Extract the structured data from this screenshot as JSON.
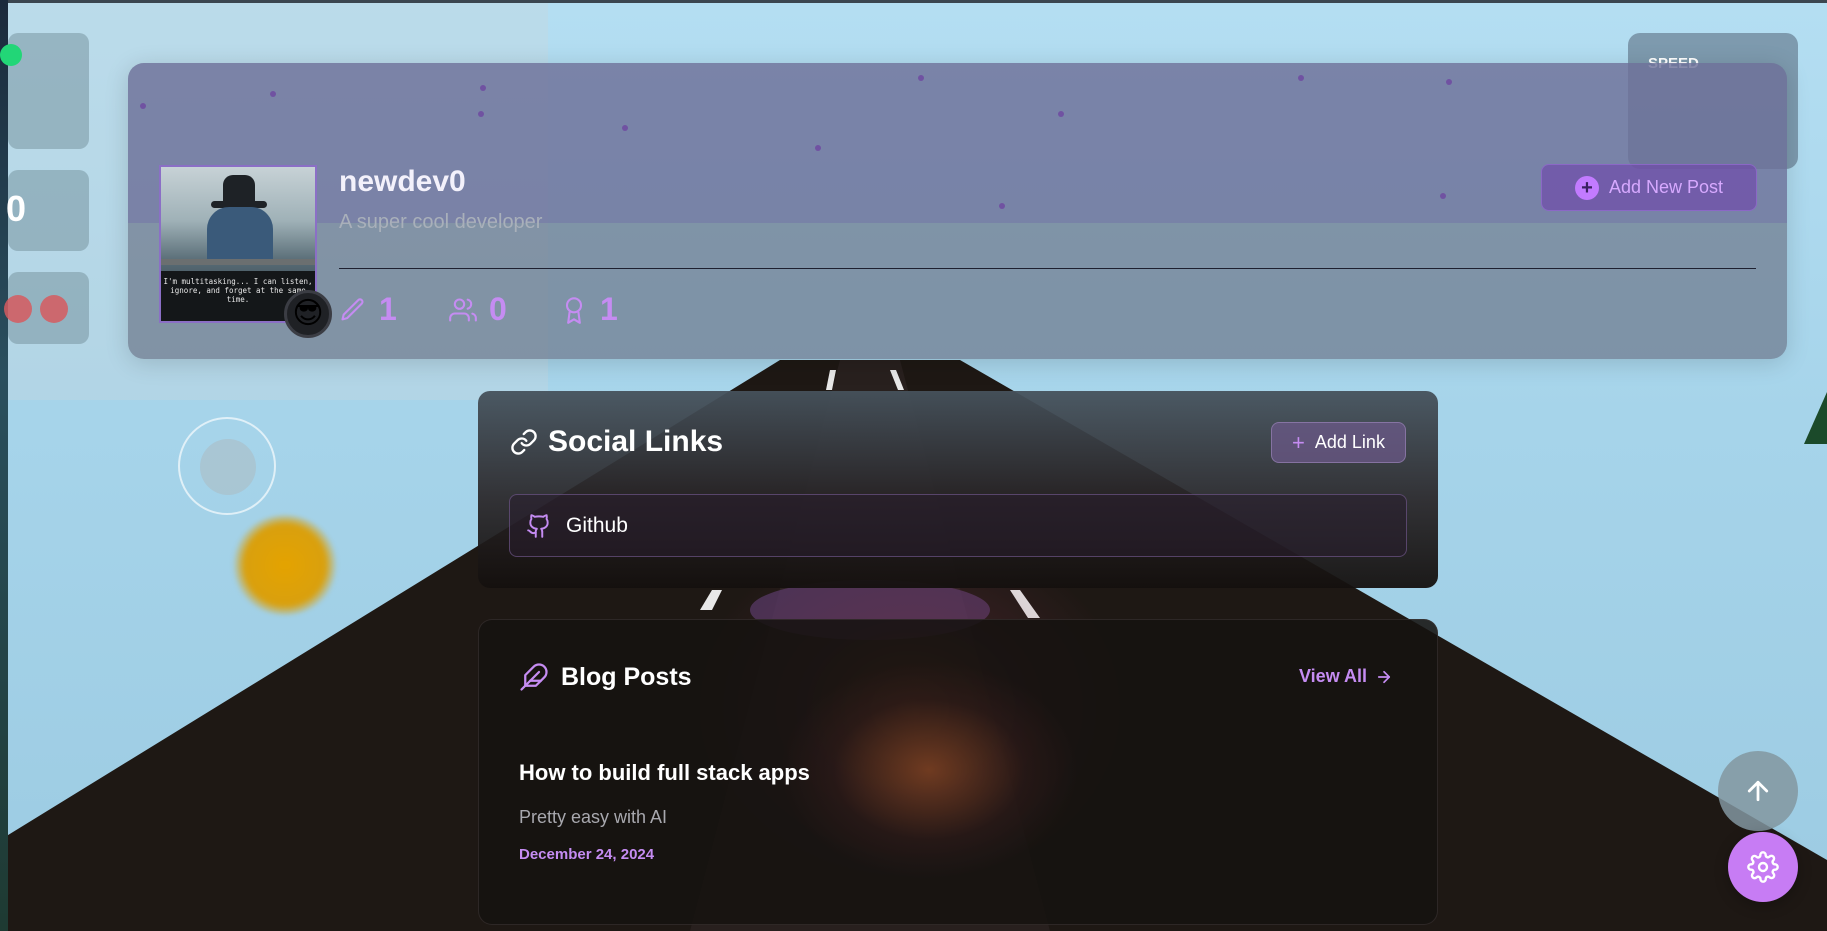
{
  "game_hud": {
    "score_value": "0",
    "speed_label": "SPEED"
  },
  "profile": {
    "username": "newdev0",
    "bio": "A super cool developer",
    "avatar_caption": "I'm multitasking... I can listen, ignore, and forget at the same time.",
    "status_emoji": "😎",
    "add_post_label": "Add New Post",
    "stats": {
      "posts": "1",
      "followers": "0",
      "achievements": "1"
    }
  },
  "social_links": {
    "title": "Social Links",
    "add_label": "Add Link",
    "items": [
      {
        "label": "Github",
        "icon": "github-icon"
      }
    ]
  },
  "blog_posts": {
    "title": "Blog Posts",
    "view_all_label": "View All",
    "posts": [
      {
        "title": "How to build full stack apps",
        "excerpt": "Pretty easy with AI",
        "date": "December 24, 2024"
      }
    ]
  },
  "colors": {
    "accent": "#c58cf2",
    "settings_button": "#c77cf4",
    "sky": "#a9d6ec"
  },
  "icons": [
    "link-icon",
    "plus-icon",
    "github-icon",
    "feather-icon",
    "arrow-right-icon",
    "arrow-up-icon",
    "gear-icon",
    "pencil-icon",
    "users-icon",
    "award-icon"
  ]
}
